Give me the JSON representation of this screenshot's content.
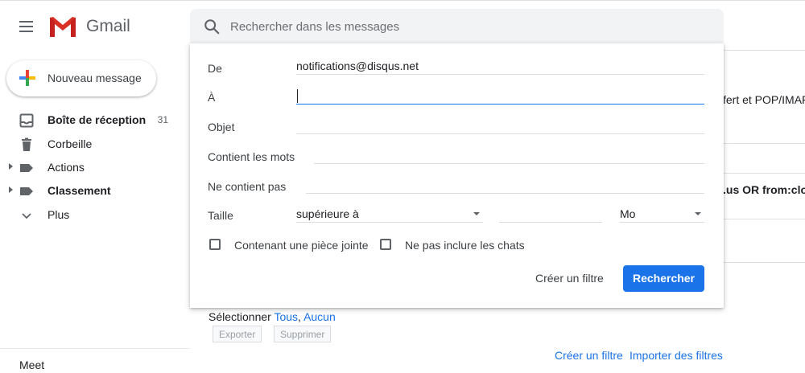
{
  "header": {
    "brand": "Gmail",
    "search_placeholder": "Rechercher dans les messages"
  },
  "sidebar": {
    "compose_label": "Nouveau message",
    "items": [
      {
        "label": "Boîte de réception",
        "count": "31",
        "icon": "inbox-icon",
        "bold": true
      },
      {
        "label": "Corbeille",
        "count": "",
        "icon": "trash-icon",
        "bold": false
      },
      {
        "label": "Actions",
        "count": "",
        "icon": "label-icon",
        "bold": false
      },
      {
        "label": "Classement",
        "count": "",
        "icon": "label-icon",
        "bold": true
      },
      {
        "label": "Plus",
        "count": "",
        "icon": "chevron-down-icon",
        "bold": false
      }
    ],
    "meet": "Meet"
  },
  "background": {
    "settings_tab_fragment": "fert et POP/IMAP",
    "filter_fragment": ".us OR from:clou",
    "select_prefix": "Sélectionner",
    "select_all": "Tous",
    "select_none": "Aucun",
    "export_button": "Exporter",
    "delete_button": "Supprimer",
    "create_filter_link": "Créer un filtre",
    "import_filters_link": "Importer des filtres"
  },
  "advanced_search": {
    "from_label": "De",
    "from_value": "notifications@disqus.net",
    "to_label": "À",
    "to_value": "",
    "subject_label": "Objet",
    "subject_value": "",
    "has_words_label": "Contient les mots",
    "has_words_value": "",
    "doesnt_have_label": "Ne contient pas",
    "doesnt_have_value": "",
    "size_label": "Taille",
    "size_operator": "supérieure à",
    "size_value": "",
    "size_unit": "Mo",
    "has_attachment_label": "Contenant une pièce jointe",
    "has_attachment_checked": false,
    "exclude_chats_label": "Ne pas inclure les chats",
    "exclude_chats_checked": false,
    "create_filter_button": "Créer un filtre",
    "search_button": "Rechercher"
  },
  "colors": {
    "accent": "#1a73e8",
    "icon_grey": "#5f6368"
  }
}
